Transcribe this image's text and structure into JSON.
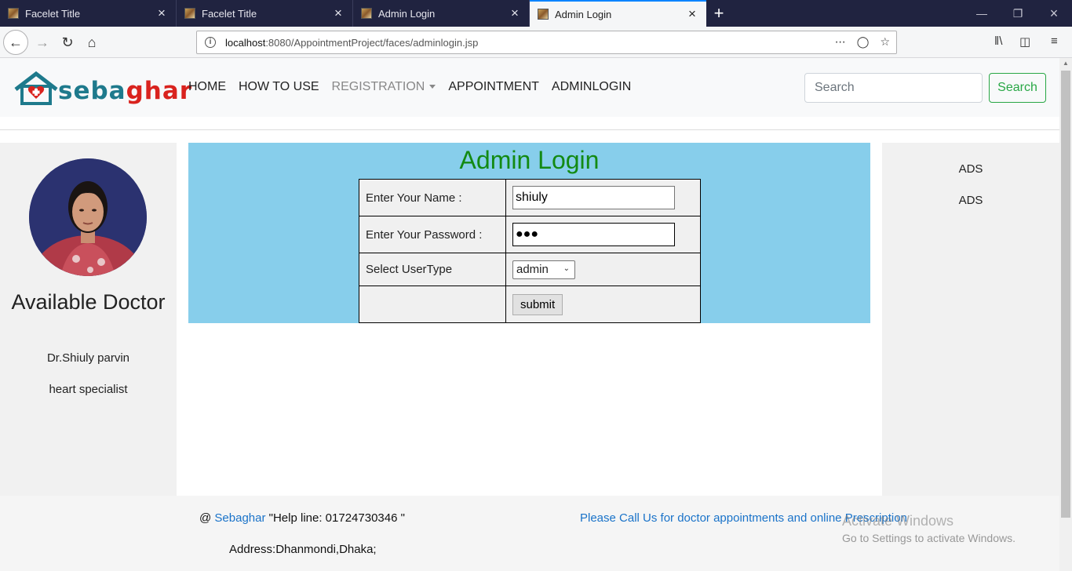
{
  "browser": {
    "tabs": [
      {
        "label": "Facelet Title",
        "active": false
      },
      {
        "label": "Facelet Title",
        "active": false
      },
      {
        "label": "Admin Login",
        "active": false
      },
      {
        "label": "Admin Login",
        "active": true
      }
    ],
    "url_host": "localhost",
    "url_path": ":8080/AppointmentProject/faces/adminlogin.jsp"
  },
  "site": {
    "logo": {
      "part1": "seba",
      "part2": "ghar"
    },
    "menu": {
      "home": "HOME",
      "how_to_use": "HOW TO USE",
      "registration": "REGISTRATION",
      "appointment": "APPOINTMENT",
      "adminlogin": "ADMINLOGIN"
    },
    "search": {
      "placeholder": "Search",
      "button": "Search"
    }
  },
  "sidebar": {
    "heading": "Available Doctor",
    "doctor_name": "Dr.Shiuly parvin",
    "specialty": "heart specialist"
  },
  "login": {
    "title": "Admin Login",
    "name_label": "Enter Your Name :",
    "name_value": "shiuly",
    "password_label": "Enter Your Password :",
    "password_value": "●●●",
    "usertype_label": "Select UserType",
    "usertype_value": "admin",
    "submit_label": "submit"
  },
  "ads": [
    "ADS",
    "ADS"
  ],
  "footer": {
    "at": "@",
    "brand_link": "Sebaghar",
    "helpline": "\"Help line: 01724730346 \"",
    "call_text": "Please Call Us for doctor appointments and online Prescription",
    "address": "Address:Dhanmondi,Dhaka;"
  },
  "watermark": {
    "line1": "Activate Windows",
    "line2": "Go to Settings to activate Windows."
  }
}
